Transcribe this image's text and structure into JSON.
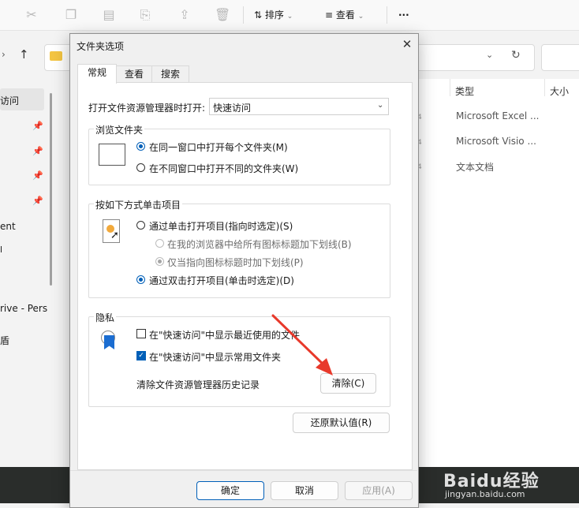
{
  "explorer": {
    "toolbar": {
      "sort_label": "排序",
      "view_label": "查看",
      "more": "···"
    },
    "nav_items": [
      "访问",
      "ent",
      "",
      "rive - Pers",
      "盾"
    ],
    "file_columns": {
      "type": "类型",
      "size": "大小"
    },
    "file_types": [
      "Microsoft Excel ...",
      "Microsoft Visio ...",
      "文本文档"
    ]
  },
  "dialog": {
    "title": "文件夹选项",
    "tabs": [
      "常规",
      "查看",
      "搜索"
    ],
    "open_explorer_label": "打开文件资源管理器时打开:",
    "open_explorer_value": "快速访问",
    "browse_group": {
      "title": "浏览文件夹",
      "options": [
        "在同一窗口中打开每个文件夹(M)",
        "在不同窗口中打开不同的文件夹(W)"
      ],
      "selected": 0
    },
    "click_group": {
      "title": "按如下方式单击项目",
      "single_click": "通过单击打开项目(指向时选定)(S)",
      "sub_options": [
        "在我的浏览器中给所有图标标题加下划线(B)",
        "仅当指向图标标题时加下划线(P)"
      ],
      "double_click": "通过双击打开项目(单击时选定)(D)"
    },
    "privacy_group": {
      "title": "隐私",
      "show_recent": "在\"快速访问\"中显示最近使用的文件",
      "show_recent_checked": false,
      "show_frequent": "在\"快速访问\"中显示常用文件夹",
      "show_frequent_checked": true,
      "clear_history_label": "清除文件资源管理器历史记录",
      "clear_button": "清除(C)"
    },
    "restore_defaults": "还原默认值(R)",
    "footer": {
      "ok": "确定",
      "cancel": "取消",
      "apply": "应用(A)"
    }
  },
  "watermark": {
    "brand": "Baidu经验",
    "url": "jingyan.baidu.com"
  },
  "colors": {
    "accent": "#005fb8",
    "arrow": "#e8392b"
  }
}
